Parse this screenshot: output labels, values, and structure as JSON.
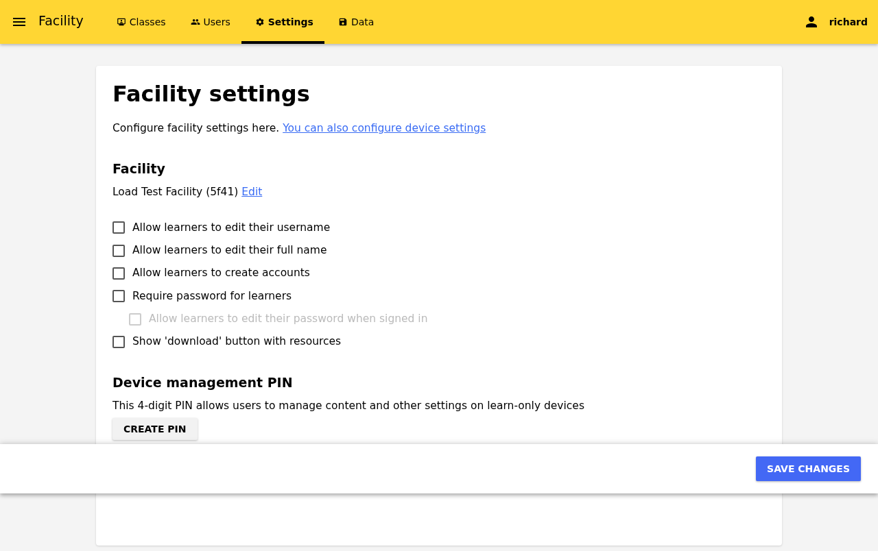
{
  "app_bar": {
    "title": "Facility",
    "tabs": [
      {
        "label": "Classes",
        "kind": "classes",
        "selected": false
      },
      {
        "label": "Users",
        "kind": "users",
        "selected": false
      },
      {
        "label": "Settings",
        "kind": "settings",
        "selected": true
      },
      {
        "label": "Data",
        "kind": "data",
        "selected": false
      }
    ],
    "user": "richard"
  },
  "page": {
    "title": "Facility settings",
    "intro": "Configure facility settings here.",
    "device_link": "You can also configure device settings",
    "facility_heading": "Facility",
    "facility_name": "Load Test Facility (5f41)",
    "edit_link": "Edit",
    "options": [
      {
        "label": "Allow learners to edit their username",
        "checked": false,
        "disabled": false
      },
      {
        "label": "Allow learners to edit their full name",
        "checked": false,
        "disabled": false
      },
      {
        "label": "Allow learners to create accounts",
        "checked": false,
        "disabled": false
      },
      {
        "label": "Require password for learners",
        "checked": false,
        "disabled": false,
        "children": [
          {
            "label": "Allow learners to edit their password when signed in",
            "checked": false,
            "disabled": true
          }
        ]
      },
      {
        "label": "Show 'download' button with resources",
        "checked": false,
        "disabled": false
      }
    ],
    "pin_heading": "Device management PIN",
    "pin_text": "This 4-digit PIN allows users to manage content and other settings on learn-only devices",
    "pin_button": "CREATE PIN"
  },
  "bottom_bar": {
    "save_button": "SAVE CHANGES"
  }
}
